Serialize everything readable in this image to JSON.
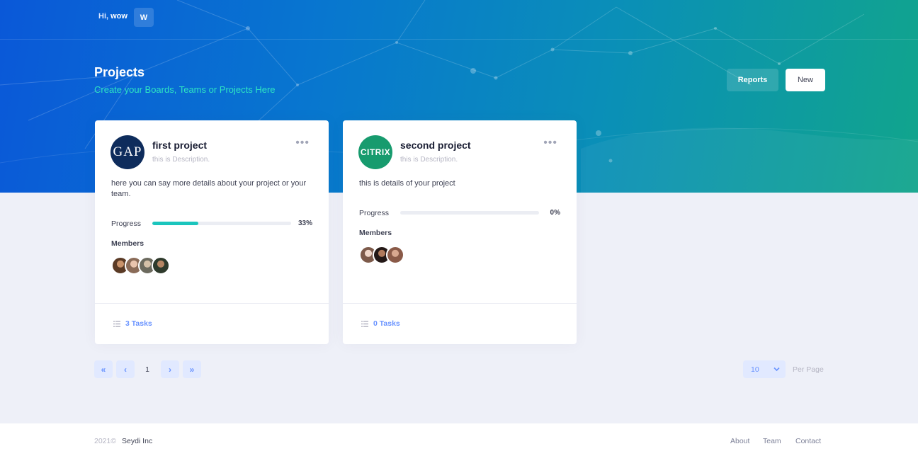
{
  "colors": {
    "accent": "#6993ff",
    "progress": "#1bc5bd",
    "subtitle": "#2ee6c3",
    "hero_start": "#0a58d8",
    "hero_end": "#11a58c"
  },
  "header": {
    "greeting_prefix": "Hi,",
    "username": "wow",
    "avatar_initial": "W"
  },
  "page": {
    "title": "Projects",
    "subtitle": "Create your Boards, Teams or Projects Here",
    "reports_label": "Reports",
    "new_label": "New"
  },
  "projects": [
    {
      "logo_icon": "gap-logo",
      "logo_text": "GAP",
      "title": "first project",
      "description": "this is Description.",
      "details": "here you can say more details about your project or your team.",
      "progress_label": "Progress",
      "progress": 0.33,
      "progress_text": "33%",
      "members_label": "Members",
      "member_count": 4,
      "tasks_label": "3 Tasks"
    },
    {
      "logo_icon": "citrix-logo",
      "logo_text": "CITRIX",
      "title": "second project",
      "description": "this is Description.",
      "details": "this is details of your project",
      "progress_label": "Progress",
      "progress": 0,
      "progress_text": "0%",
      "members_label": "Members",
      "member_count": 3,
      "tasks_label": "0 Tasks"
    }
  ],
  "pagination": {
    "first_icon": "double-chevron-left-icon",
    "prev_icon": "chevron-left-icon",
    "current_page": "1",
    "next_icon": "chevron-right-icon",
    "last_icon": "double-chevron-right-icon",
    "per_page_value": "10",
    "per_page_label": "Per Page"
  },
  "footer": {
    "year": "2021©",
    "company": "Seydi Inc",
    "links": [
      "About",
      "Team",
      "Contact"
    ]
  }
}
